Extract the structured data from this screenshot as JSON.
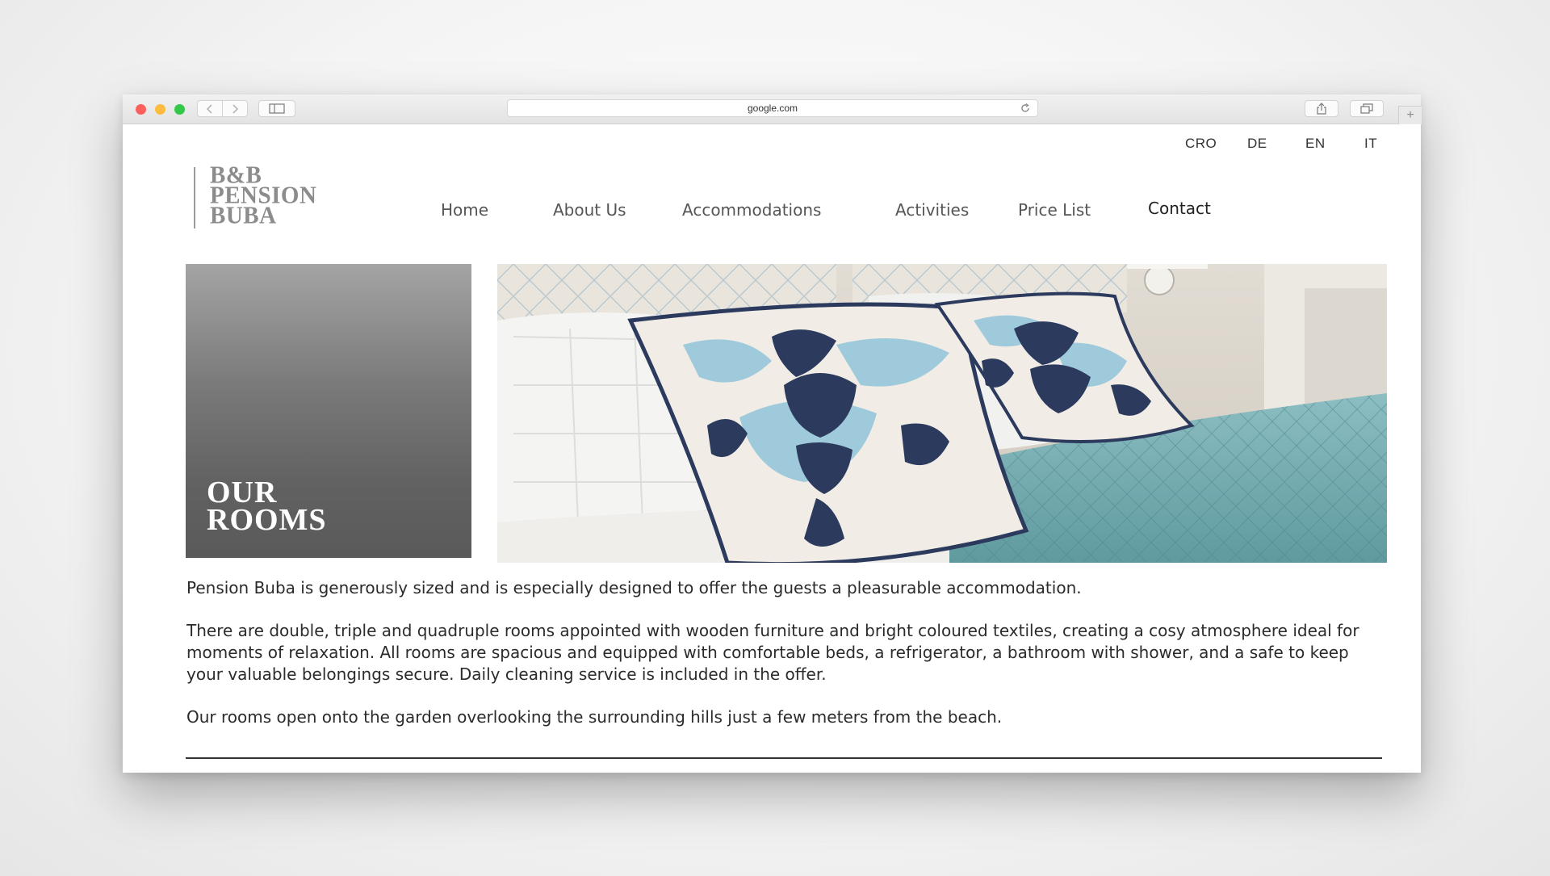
{
  "browser": {
    "url": "google.com"
  },
  "languages": [
    "CRO",
    "DE",
    "EN",
    "IT"
  ],
  "logo": {
    "lines": [
      "B&B",
      "PENSION",
      "BUBA"
    ]
  },
  "nav": {
    "items": [
      "Home",
      "About Us",
      "Accommodations",
      "Activities",
      "Price List",
      "Contact"
    ]
  },
  "hero": {
    "title_line1": "OUR",
    "title_line2": "ROOMS"
  },
  "content": {
    "p1": "Pension Buba is generously sized and is especially designed to offer the guests a pleasurable accommodation.",
    "p2": "There are double, triple and quadruple rooms appointed with wooden furniture and bright coloured textiles, creating a cosy atmosphere ideal for moments of relaxation. All rooms are spacious and equipped with comfortable beds, a refrigerator, a bathroom with shower, and a safe to keep your valuable belongings secure.  Daily cleaning service is included in the offer.",
    "p3": "Our rooms open onto the garden overlooking the surrounding hills just a few meters from the beach."
  },
  "colors": {
    "close": "#fc605c",
    "minimize": "#fdbc40",
    "zoom": "#34c84a",
    "pillow_navy": "#2c3a5e",
    "pillow_light_blue": "#9fcadb",
    "bedspread_teal": "#6fa6ab"
  }
}
